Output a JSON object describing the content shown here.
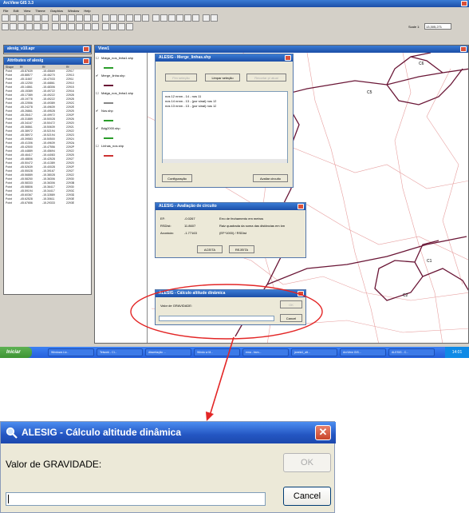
{
  "app": {
    "title": "ArcView GIS 3.3",
    "menu": [
      "File",
      "Edit",
      "View",
      "Theme",
      "Graphics",
      "Window",
      "Help"
    ],
    "scale_label": "Scale 1:",
    "scale_value": "13,305,271"
  },
  "table_window": {
    "title": "alesig_v10.apr",
    "attributes_title": "Attributes of alesig",
    "columns": [
      "Shape",
      "Rf",
      "Rf",
      "Rf"
    ],
    "rows": [
      [
        "Point",
        "-45.87639",
        "-15.45669",
        "22917"
      ],
      [
        "Point",
        "-45.88577",
        "-15.46270",
        "22913"
      ],
      [
        "Point",
        "-45.11667",
        "-15.47033",
        "22911"
      ],
      [
        "Point",
        "-45.12250",
        "-15.46861",
        "22910"
      ],
      [
        "Point",
        "-45.14861",
        "-15.48306",
        "22915"
      ],
      [
        "Point",
        "-45.15389",
        "-15.49722",
        "22916"
      ],
      [
        "Point",
        "-45.17389",
        "-15.49222",
        "22928"
      ],
      [
        "Point",
        "-45.19778",
        "-15.49222",
        "22928"
      ],
      [
        "Point",
        "-45.22556",
        "-15.49389",
        "2292C"
      ],
      [
        "Point",
        "-45.24278",
        "-15.49639",
        "2292E"
      ],
      [
        "Point",
        "-45.26861",
        "-15.49528",
        "22925"
      ],
      [
        "Point",
        "-45.28417",
        "-15.49972",
        "2292F"
      ],
      [
        "Point",
        "-45.31889",
        "-15.50028",
        "22926"
      ],
      [
        "Point",
        "-45.34167",
        "-15.50472",
        "22920"
      ],
      [
        "Point",
        "-45.36861",
        "-15.50639",
        "22921"
      ],
      [
        "Point",
        "-45.38972",
        "-15.52194",
        "22922"
      ],
      [
        "Point",
        "-45.38972",
        "-15.52194",
        "22923"
      ],
      [
        "Point",
        "-45.39583",
        "-15.50500",
        "22924"
      ],
      [
        "Point",
        "-45.41306",
        "-15.49639",
        "2292A"
      ],
      [
        "Point",
        "-45.42500",
        "-15.47556",
        "2292P"
      ],
      [
        "Point",
        "-45.44889",
        "-15.45694",
        "22922"
      ],
      [
        "Point",
        "-45.46417",
        "-15.44083",
        "22925"
      ],
      [
        "Point",
        "-45.48806",
        "-15.42528",
        "22927"
      ],
      [
        "Point",
        "-45.50472",
        "-15.41389",
        "22920"
      ],
      [
        "Point",
        "-45.52639",
        "-15.40028",
        "2292F"
      ],
      [
        "Point",
        "-45.55028",
        "-15.39167",
        "22927"
      ],
      [
        "Point",
        "-45.56889",
        "-15.38028",
        "22922"
      ],
      [
        "Point",
        "-45.58250",
        "-15.36306",
        "22930"
      ],
      [
        "Point",
        "-45.58333",
        "-15.36306",
        "2293B"
      ],
      [
        "Point",
        "-45.58806",
        "-15.36417",
        "22930"
      ],
      [
        "Point",
        "-45.59194",
        "-15.34417",
        "2293C"
      ],
      [
        "Point",
        "-45.60367",
        "-15.32889",
        "2293D"
      ],
      [
        "Point",
        "-45.62528",
        "-15.30611",
        "2293E"
      ],
      [
        "Point",
        "-45.67656",
        "-15.29333",
        "2293E"
      ]
    ]
  },
  "legend": {
    "title": "View1",
    "layers": [
      {
        "name": "Malga_nos_linha1.shp",
        "checked": false
      },
      {
        "name": "Merge_linha.shp",
        "checked": true
      },
      {
        "name": "Malga_nos_linha1.shp",
        "checked": false
      },
      {
        "name": "Nos.shp",
        "checked": true
      },
      {
        "name": "Bdg2000.shp",
        "checked": true
      },
      {
        "name": "Linhas_nos.shp",
        "checked": false
      }
    ]
  },
  "map": {
    "circuit_labels": [
      "C5",
      "C6",
      "C1",
      "C2"
    ],
    "colors": {
      "boundary": "#6a1636",
      "roads": "#e7a0a0"
    }
  },
  "dialog_linhas": {
    "title": "ALESIG - Merge_linhas.shp",
    "buttons": [
      "Fim seleção",
      "Limpar seleção",
      "Recortar p/ atual"
    ],
    "list": [
      "nos 12 nnnn  -  14 -                nos 11",
      "nos 14 nnnn  -  13 -   (por sinal)  nos 13",
      "nos 13 nnnn  -  13 -   (por sinal)  nos 12"
    ],
    "config_label": "Configuração",
    "evaluate_label": "Avaliar circuito"
  },
  "dialog_avaliacao": {
    "title": "ALESIG - Avaliação de circuito",
    "rows": [
      {
        "key": "EF:",
        "value": "-0.0267",
        "desc": "Erro de fechamento em metros"
      },
      {
        "key": "RSDist:",
        "value": "11.8607",
        "desc": "Raiz quadrada da soma das distâncias em km"
      },
      {
        "key": "Acurácia:",
        "value": "-1.77163",
        "desc": "(EF*1000) / RSDist"
      }
    ],
    "accept_label": "ACEITA",
    "reject_label": "REJEITA"
  },
  "dialog_altitude_small": {
    "title": "ALESIG - Cálculo altitude dinâmica",
    "label": "Valor de GRAVIDADE:",
    "ok_label": "OK",
    "cancel_label": "Cancel"
  },
  "taskbar": {
    "start_label": "Iniciar",
    "items": [
      "Windows Liv...",
      "Tetwork - Cl...",
      "dissertação ...",
      "Windo w M...",
      "ema - bsm...",
      "janela1_alt...",
      "ArcView GIS...",
      "ALESIG - C..."
    ],
    "clock": "14:01"
  },
  "zoom_dialog": {
    "title": "ALESIG  -  Cálculo altitude dinâmica",
    "label": "Valor de GRAVIDADE:",
    "ok_label": "OK",
    "cancel_label": "Cancel",
    "input_value": ""
  },
  "colors": {
    "xp_blue": "#2456c2",
    "highlight_red": "#e32626",
    "map_boundary": "#6a1636"
  }
}
